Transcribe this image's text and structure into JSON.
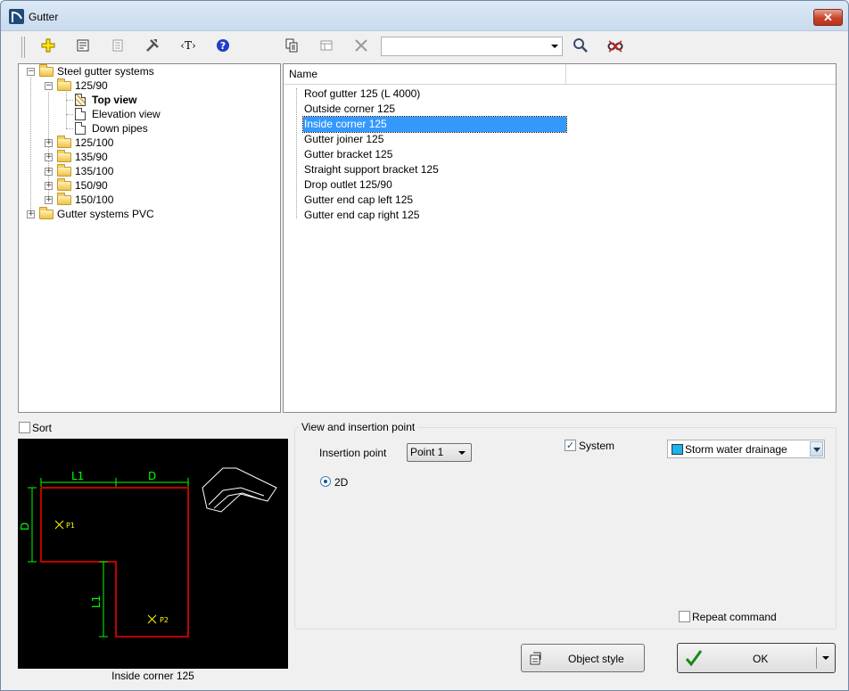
{
  "window": {
    "title": "Gutter",
    "close_glyph": "✕"
  },
  "toolbar": {
    "icons": [
      "add-icon",
      "properties-icon",
      "list-icon",
      "tools-icon",
      "text-icon",
      "help-icon",
      "copy-icon",
      "table-icon",
      "delete-icon",
      "search-icon",
      "find-icon"
    ],
    "text_icon_label": "‹T›",
    "search_value": ""
  },
  "tree": {
    "items": [
      {
        "label": "Steel gutter systems",
        "expanded": true
      },
      {
        "label": "125/90",
        "expanded": true
      },
      {
        "label": "Top view",
        "selected": true
      },
      {
        "label": "Elevation view"
      },
      {
        "label": "Down pipes"
      },
      {
        "label": "125/100"
      },
      {
        "label": "135/90"
      },
      {
        "label": "135/100"
      },
      {
        "label": "150/90"
      },
      {
        "label": "150/100"
      },
      {
        "label": "Gutter systems PVC"
      }
    ]
  },
  "list": {
    "column_header": "Name",
    "items": [
      "Roof gutter 125 (L 4000)",
      "Outside corner 125",
      "Inside corner 125",
      "Gutter joiner 125",
      "Gutter bracket 125",
      "Straight support bracket 125",
      "Drop outlet 125/90",
      "Gutter end cap left 125",
      "Gutter end cap right 125"
    ],
    "selected_index": 2
  },
  "sort": {
    "label": "Sort",
    "checked": false
  },
  "preview": {
    "caption": "Inside corner 125",
    "labels": {
      "l1_top": "L1",
      "d_top": "D",
      "d_left": "D",
      "l1_left": "L1",
      "p1": "P1",
      "p2": "P2"
    },
    "colors": {
      "background": "#000000",
      "outline": "#ff0000",
      "dimension": "#00ff00",
      "point": "#ffff00",
      "sketch": "#ffffff"
    }
  },
  "view_group": {
    "title": "View and insertion point",
    "insertion_label": "Insertion point",
    "insertion_value": "Point 1",
    "radio_2d_label": "2D",
    "system_label": "System",
    "system_checked": true,
    "system_value": "Storm water drainage",
    "system_color": "#1ab4f0",
    "repeat_label": "Repeat command",
    "repeat_checked": false
  },
  "buttons": {
    "object_style": "Object style",
    "ok": "OK"
  }
}
